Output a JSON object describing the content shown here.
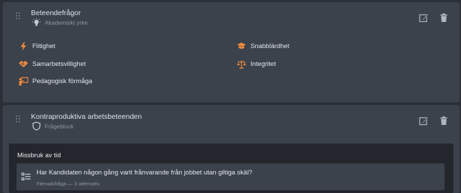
{
  "card1": {
    "title": "Beteendefrågor",
    "subtitle": "Akademiskt yrke",
    "subtitle_icon": "lightbulb-icon",
    "actions": [
      "edit-icon",
      "trash-icon"
    ],
    "traits": [
      {
        "label": "Flitighet",
        "icon": "lightning-icon"
      },
      {
        "label": "Snabblärdhet",
        "icon": "graduation-cap-icon"
      },
      {
        "label": "Samarbetsvillighet",
        "icon": "handshake-icon"
      },
      {
        "label": "Integritet",
        "icon": "balance-scale-icon"
      },
      {
        "label": "Pedagogisk förmåga",
        "icon": "presentation-icon"
      }
    ]
  },
  "card2": {
    "title": "Kontraproduktiva arbetsbeteenden",
    "subtitle": "Frågeblock",
    "subtitle_icon": "shield-icon",
    "actions": [
      "edit-icon",
      "trash-icon"
    ],
    "section": {
      "title": "Missbruk av tid",
      "question": {
        "text": "Har Kandidaten någon gång varit frånvarande från jobbet utan giltiga skäl?",
        "meta": "Flervalsfråga — 3 alternativ",
        "icon": "multiple-choice-list-icon"
      }
    }
  },
  "colors": {
    "background": "#2b3037",
    "card": "#3b424c",
    "inner_panel": "#23272d",
    "accent": "#f08a3c",
    "muted_text": "#8f97a2"
  }
}
